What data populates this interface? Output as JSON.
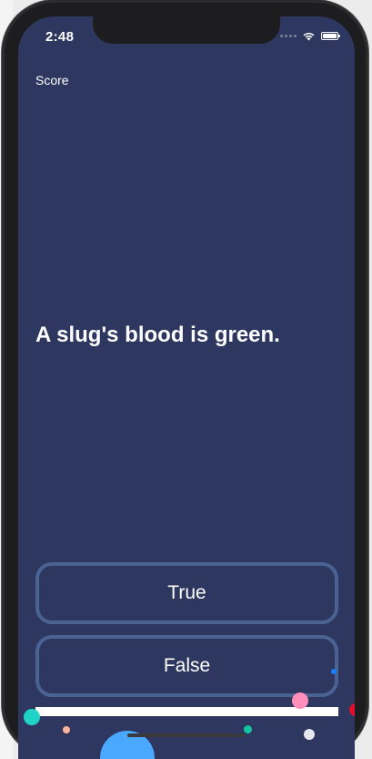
{
  "status_bar": {
    "time": "2:48",
    "icons": [
      "cellular-signal-icon",
      "wifi-icon",
      "battery-icon"
    ]
  },
  "quiz": {
    "score_label": "Score",
    "question": "A slug's blood is green.",
    "answers": {
      "true_label": "True",
      "false_label": "False"
    },
    "progress": 1.0
  },
  "colors": {
    "background": "#2d3760",
    "button_border": "#4a6392",
    "text": "#ffffff",
    "confetti": [
      "#1fd3c6",
      "#ff8fb8",
      "#ffb3a0",
      "#12c4a0",
      "#ffffff",
      "#4aa8ff",
      "#e0102a",
      "#1a7cff"
    ]
  }
}
